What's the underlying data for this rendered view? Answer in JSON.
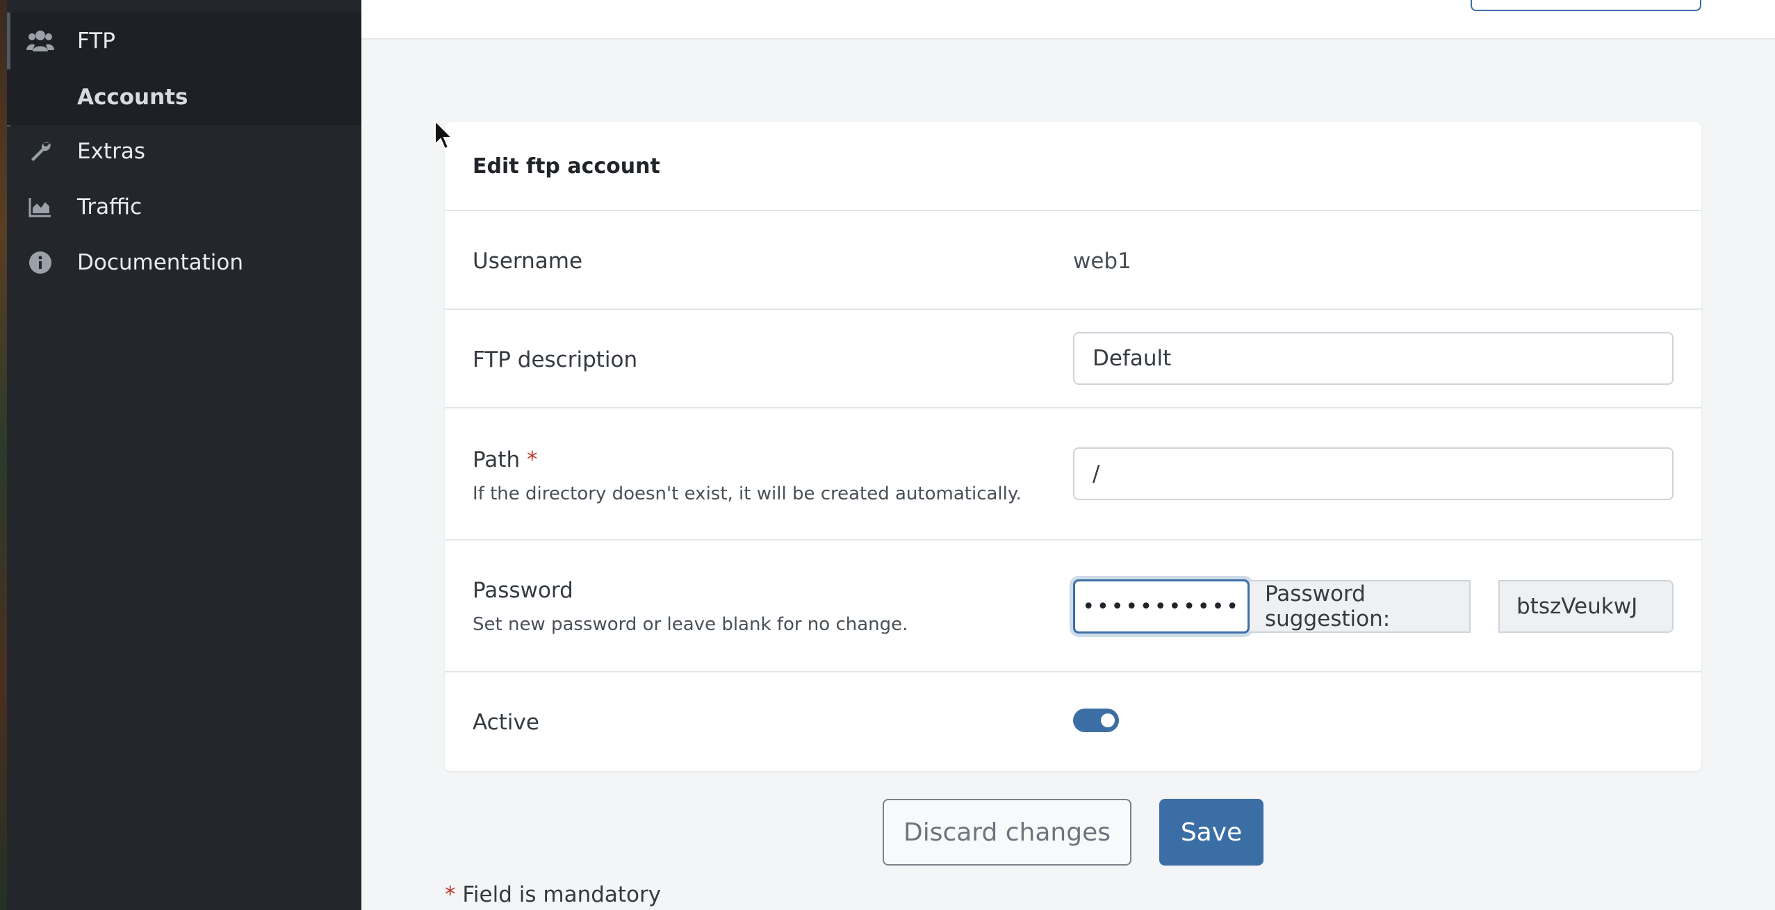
{
  "sidebar": {
    "items": [
      {
        "label": "FTP",
        "icon": "users-icon"
      },
      {
        "label": "Accounts"
      },
      {
        "label": "Extras",
        "icon": "wrench-icon"
      },
      {
        "label": "Traffic",
        "icon": "area-chart-icon"
      },
      {
        "label": "Documentation",
        "icon": "info-circle-icon"
      }
    ]
  },
  "card": {
    "title": "Edit ftp account",
    "username": {
      "label": "Username",
      "value": "web1"
    },
    "description": {
      "label": "FTP description",
      "value": "Default"
    },
    "path": {
      "label": "Path",
      "required_mark": "*",
      "help": "If the directory doesn't exist, it will be created automatically.",
      "value": "/"
    },
    "password": {
      "label": "Password",
      "help": "Set new password or leave blank for no change.",
      "masked_value": "•••••••••••",
      "suggestion_label": "Password suggestion:",
      "suggestion_value": "btszVeukwJ"
    },
    "active": {
      "label": "Active",
      "checked": true
    }
  },
  "actions": {
    "discard_label": "Discard changes",
    "save_label": "Save"
  },
  "footer": {
    "required_mark": "*",
    "mandatory_note": "Field is mandatory"
  },
  "colors": {
    "accent": "#3b6ea5",
    "sidebar_bg": "#23272b",
    "required": "#c0392b"
  }
}
